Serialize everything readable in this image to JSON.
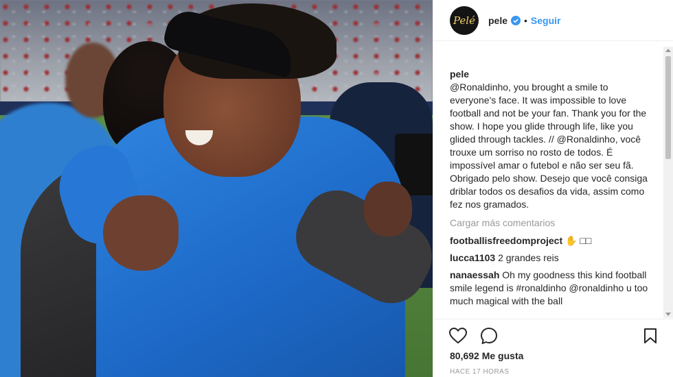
{
  "post": {
    "author": "pele",
    "avatar_text": "Pelé",
    "separator": "•",
    "follow_label": "Seguir"
  },
  "caption": {
    "user": "pele",
    "text": "@Ronaldinho, you brought a smile to everyone's face. It was impossible to love football and not be your fan. Thank you for the show. I hope you glide through life, like you glided through tackles. // @Ronaldinho, você trouxe um sorriso no rosto de todos. É impossível amar o futebol e não ser seu fã. Obrigado pelo show. Desejo que você consiga driblar todos os desafios da vida, assim como fez nos gramados."
  },
  "load_more_label": "Cargar más comentarios",
  "comments": [
    {
      "user": "footballisfreedomproject",
      "text": "✋ □□"
    },
    {
      "user": "lucca1103",
      "text": "2 grandes reis"
    },
    {
      "user": "nanaessah",
      "text": "Oh my goodness this kind football smile legend is #ronaldinho @ronaldinho u too much magical with the ball"
    }
  ],
  "actions": {
    "like_icon": "heart-icon",
    "comment_icon": "comment-bubble-icon",
    "save_icon": "bookmark-icon"
  },
  "likes_label": "80,692 Me gusta",
  "time_label": "HACE 17 HORAS",
  "colors": {
    "link": "#3897f0",
    "verified": "#3897f0",
    "muted": "#999999",
    "text": "#262626"
  }
}
